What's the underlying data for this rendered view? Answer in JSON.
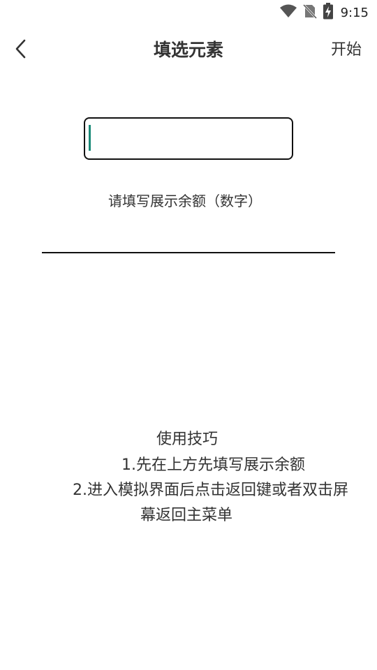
{
  "status_bar": {
    "time": "9:15",
    "icons": [
      "wifi-icon",
      "no-sim-icon",
      "battery-charging-icon"
    ]
  },
  "app_bar": {
    "title": "填选元素",
    "back_icon": "chevron-left-icon",
    "action_label": "开始"
  },
  "amount_input": {
    "value": "",
    "placeholder": "",
    "hint": "请填写展示余额（数字）"
  },
  "tips": {
    "heading": "使用技巧",
    "line1": "1.先在上方先填写展示余额",
    "line2": "2.进入模拟界面后点击返回键或者双击屏",
    "line3": "幕返回主菜单"
  },
  "colors": {
    "accent": "#1b8a78",
    "text": "#333333",
    "border": "#111111"
  }
}
